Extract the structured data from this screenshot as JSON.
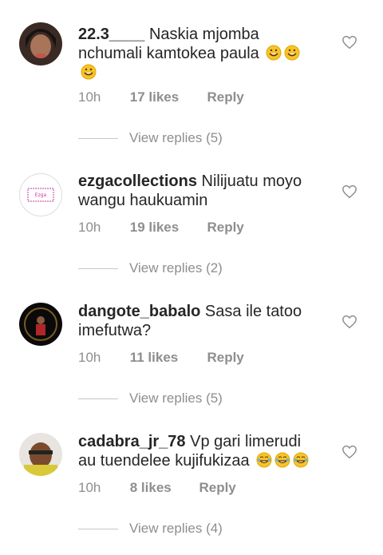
{
  "comments": [
    {
      "username": "22.3____",
      "text": "Naskia mjomba nchumali kamtokea paula",
      "emojis": "🤣🤣🤣",
      "time": "10h",
      "likes": "17 likes",
      "reply": "Reply",
      "view_replies": "View replies (5)"
    },
    {
      "username": "ezgacollections",
      "text": "Nilijuatu moyo wangu haukuamin",
      "time": "10h",
      "likes": "19 likes",
      "reply": "Reply",
      "view_replies": "View replies (2)"
    },
    {
      "username": "dangote_babalo",
      "text": "Sasa ile tatoo imefutwa?",
      "time": "10h",
      "likes": "11 likes",
      "reply": "Reply",
      "view_replies": "View replies (5)"
    },
    {
      "username": "cadabra_jr_78",
      "text": "Vp gari limerudi au tuendelee kujifukizaa",
      "emojis": "😂😂😂",
      "time": "10h",
      "likes": "8 likes",
      "reply": "Reply",
      "view_replies": "View replies (4)"
    }
  ],
  "icons": {
    "like": "heart-outline-icon"
  },
  "colors": {
    "text": "#262626",
    "secondary": "#8e8e8e",
    "divider": "#c7c7c7"
  }
}
